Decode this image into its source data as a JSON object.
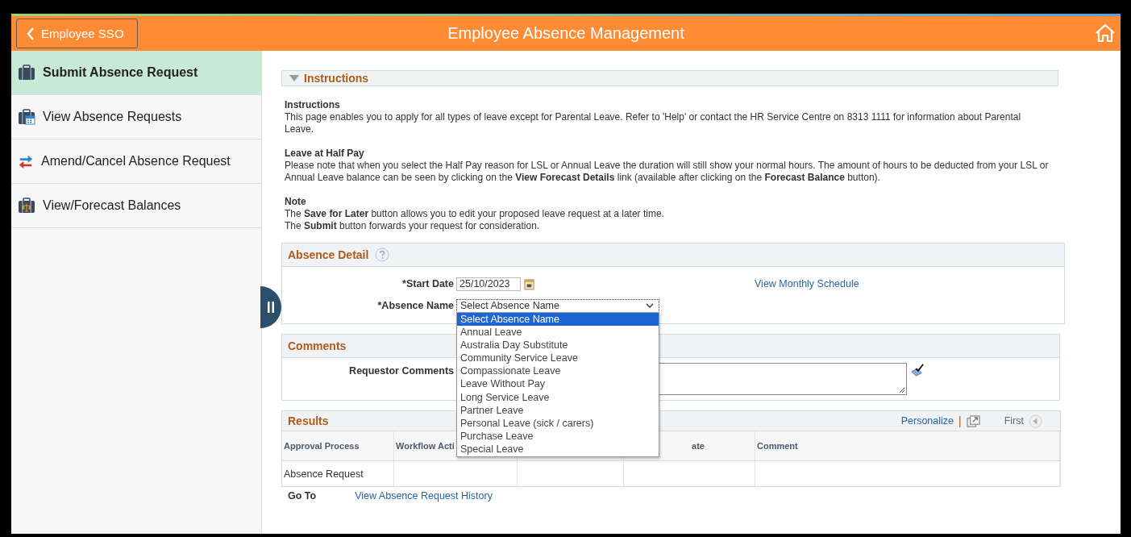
{
  "header": {
    "back_button": "Employee SSO",
    "title": "Employee Absence Management"
  },
  "sidebar": {
    "items": [
      {
        "label": "Submit Absence Request",
        "kind": "submit",
        "selected": true
      },
      {
        "label": "View Absence Requests",
        "kind": "view",
        "selected": false
      },
      {
        "label": "Amend/Cancel Absence Request",
        "kind": "amend",
        "selected": false
      },
      {
        "label": "View/Forecast Balances",
        "kind": "balances",
        "selected": false
      }
    ]
  },
  "instructions": {
    "title": "Instructions",
    "expanded": true,
    "blocks": [
      {
        "heading": "Instructions",
        "lines": [
          "This page enables you to apply for all types of leave except for Parental Leave. Refer to 'Help' or contact the HR Service Centre on 8313 1111 for information about Parental Leave."
        ]
      },
      {
        "heading": "Leave at Half Pay",
        "lines": [
          "Please note that when you select the Half Pay reason for LSL or Annual Leave the duration will still show your normal hours. The amount of hours to be deducted from your LSL or Annual Leave balance can be seen by clicking on the **View Forecast Details** link (available after clicking on the **Forecast Balance** button)."
        ]
      },
      {
        "heading": "Note",
        "lines": [
          "The **Save for Later** button allows you to edit your proposed leave request at a later time.",
          "The **Submit** button forwards your request for consideration."
        ]
      }
    ]
  },
  "absence_detail": {
    "title": "Absence Detail",
    "start_date": {
      "label": "*Start Date",
      "value": "25/10/2023"
    },
    "monthly_schedule_link": "View Monthly Schedule",
    "absence_name": {
      "label": "*Absence Name",
      "value": "Select Absence Name",
      "expanded": true,
      "options": [
        {
          "label": "Select Absence Name",
          "selected": true
        },
        {
          "label": "Annual Leave",
          "selected": false
        },
        {
          "label": "Australia Day Substitute",
          "selected": false
        },
        {
          "label": "Community Service Leave",
          "selected": false
        },
        {
          "label": "Compassionate Leave",
          "selected": false
        },
        {
          "label": "Leave Without Pay",
          "selected": false
        },
        {
          "label": "Long Service Leave",
          "selected": false
        },
        {
          "label": "Partner Leave",
          "selected": false
        },
        {
          "label": "Personal Leave (sick / carers)",
          "selected": false
        },
        {
          "label": "Purchase Leave",
          "selected": false
        },
        {
          "label": "Special Leave",
          "selected": false
        }
      ]
    }
  },
  "comments": {
    "title": "Comments",
    "requestor_label": "Requestor Comments"
  },
  "results": {
    "title": "Results",
    "personalize": "Personalize",
    "separator": "|",
    "first": "First",
    "columns": [
      "Approval Process",
      "Workflow Acti",
      "",
      "ate",
      "Comment"
    ],
    "rows": [
      [
        "Absence Request",
        "",
        "",
        "",
        ""
      ]
    ]
  },
  "go_to": {
    "label": "Go To",
    "link": "View Absence Request History"
  }
}
